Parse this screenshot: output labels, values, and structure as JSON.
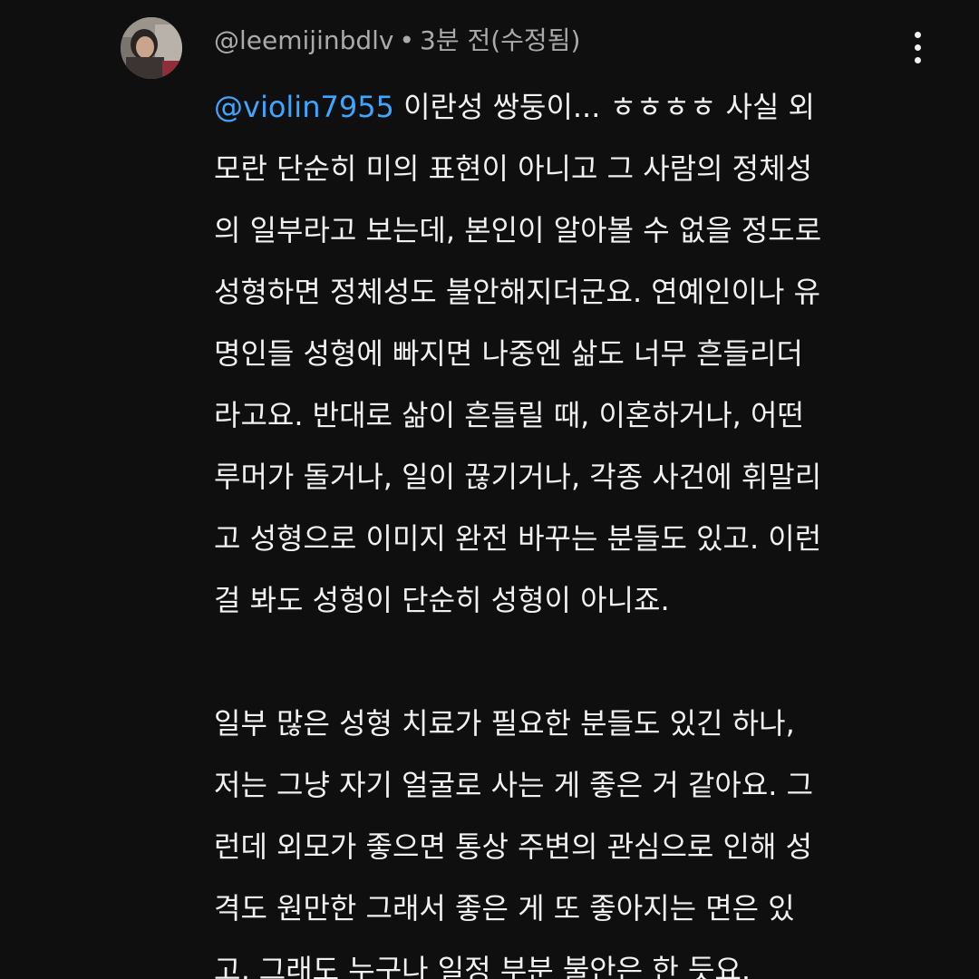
{
  "comment": {
    "author": "@leemijinbdlv",
    "separator": "•",
    "time": "3분 전(수정됨)",
    "mention": "@violin7955",
    "first_line_rest": " 이란성 쌍둥이... ㅎㅎㅎㅎ 사실 외",
    "lines_para1": [
      "모란 단순히 미의 표현이 아니고 그 사람의 정체성",
      "의 일부라고 보는데, 본인이 알아볼 수 없을 정도로",
      "성형하면 정체성도 불안해지더군요. 연예인이나 유",
      "명인들 성형에 빠지면 나중엔 삶도 너무 흔들리더",
      "라고요. 반대로 삶이 흔들릴 때, 이혼하거나, 어떤",
      "루머가 돌거나, 일이 끊기거나, 각종 사건에 휘말리",
      "고 성형으로 이미지 완전 바꾸는 분들도 있고. 이런",
      "걸 봐도 성형이 단순히 성형이 아니죠."
    ],
    "lines_para2": [
      "일부 많은 성형 치료가 필요한 분들도 있긴 하나,",
      "저는 그냥 자기 얼굴로 사는 게 좋은 거 같아요. 그",
      "런데 외모가 좋으면 통상 주변의 관심으로 인해 성",
      "격도 원만한 그래서 좋은 게 또 좋아지는 면은 있",
      "고, 그래도 누구나 일정 부분 불안은 한 듯요."
    ]
  },
  "icons": {
    "avatar": "avatar-image",
    "more": "more-vert-icon"
  },
  "colors": {
    "background": "#0f0f0f",
    "text": "#f1f1f1",
    "meta": "#aaaaaa",
    "mention": "#3ea6ff"
  }
}
